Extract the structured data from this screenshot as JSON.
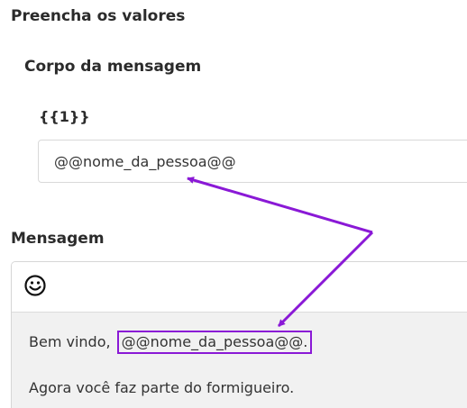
{
  "form": {
    "title": "Preencha os valores",
    "body_section_title": "Corpo da mensagem",
    "variable_label": "{{1}}",
    "variable_value": "@@nome_da_pessoa@@"
  },
  "message": {
    "label": "Mensagem",
    "line1_prefix": "Bem vindo,",
    "line1_highlight": "@@nome_da_pessoa@@.",
    "line2": "Agora você faz parte do formigueiro."
  },
  "colors": {
    "annotation": "#8a19d6"
  },
  "icons": {
    "emoji": "smiley-face-icon"
  }
}
